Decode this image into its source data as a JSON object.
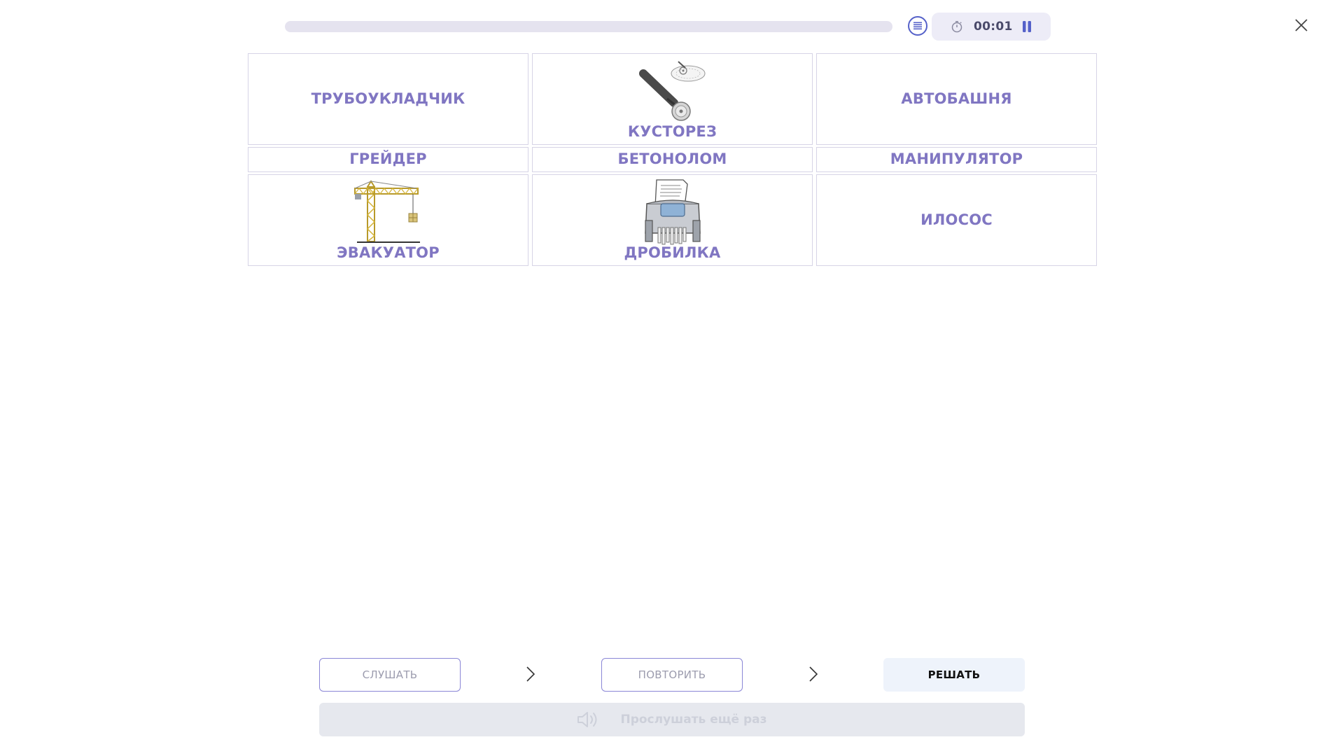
{
  "header": {
    "progress": 0,
    "timer": "00:01",
    "icons": {
      "list": "list-icon",
      "timer": "stopwatch-icon",
      "pause": "pause-icon",
      "close": "close-icon"
    }
  },
  "cards": [
    {
      "label": "ТРУБОУКЛАДЧИК"
    },
    {
      "label": "КУСТОРЕЗ",
      "image": "pizza-cutter-image"
    },
    {
      "label": "АВТОБАШНЯ"
    },
    {
      "label": "ГРЕЙДЕР"
    },
    {
      "label": "БЕТОНОЛОМ"
    },
    {
      "label": "МАНИПУЛЯТОР"
    },
    {
      "label": "ЭВАКУАТОР",
      "image": "tower-crane-image"
    },
    {
      "label": "ДРОБИЛКА",
      "image": "paper-shredder-image"
    },
    {
      "label": "ИЛОСОС"
    }
  ],
  "controls": {
    "listen": "СЛУШАТЬ",
    "repeat": "ПОВТОРИТЬ",
    "solve": "РЕШАТЬ",
    "listen_again": "Прослушать ещё раз"
  },
  "colors": {
    "accent": "#8076c2",
    "card_border": "#d6d4e6",
    "button_border": "#8a86d6",
    "solve_bg": "#eef3fb",
    "disabled_bg": "#e6e8ee"
  }
}
